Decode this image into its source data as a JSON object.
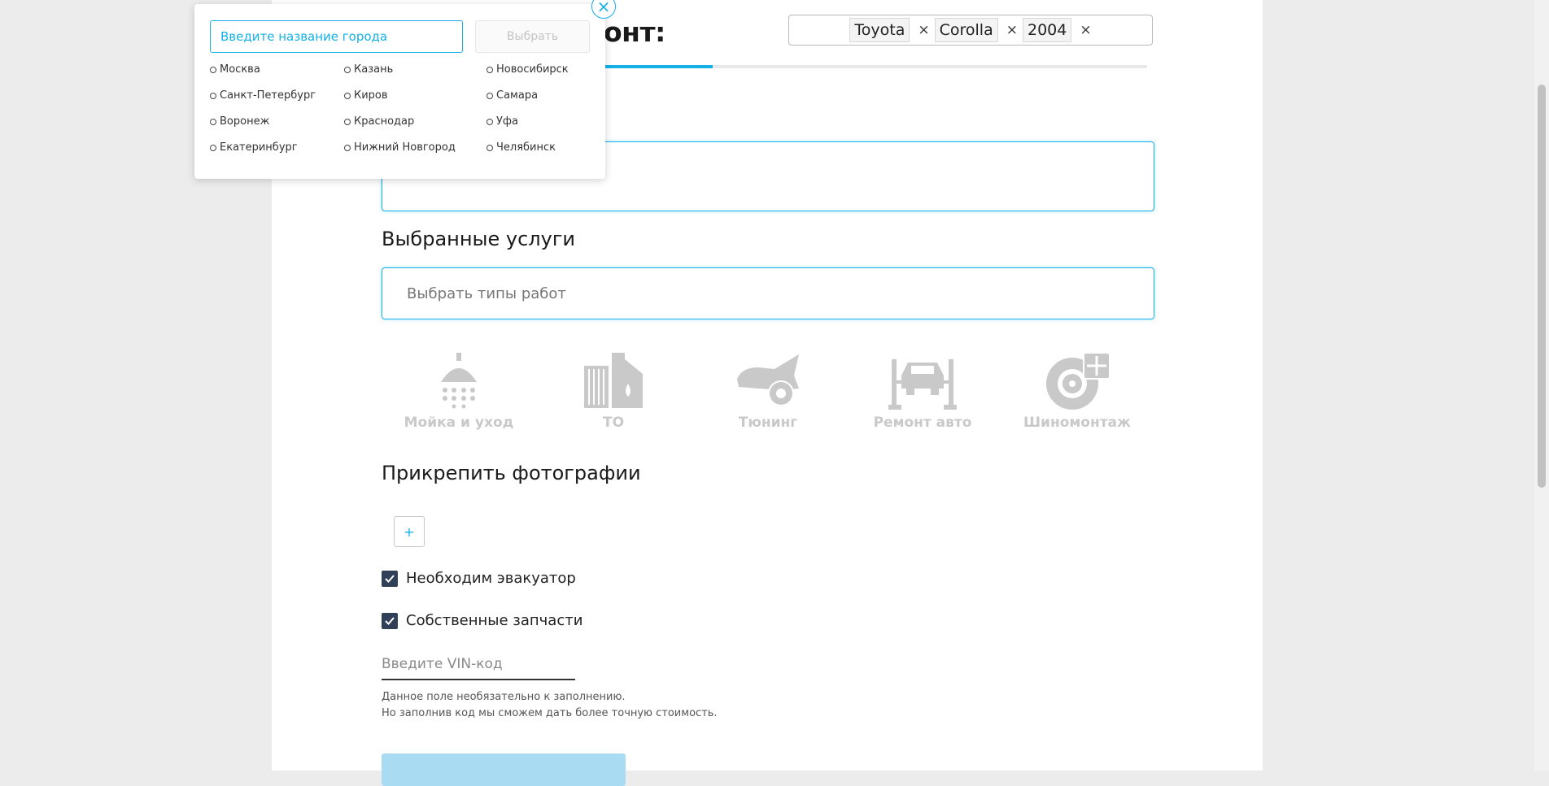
{
  "header": {
    "title_tail": "онт:",
    "car_tags": [
      {
        "label": "Toyota",
        "remove": "×"
      },
      {
        "label": "Corolla",
        "remove": "×"
      },
      {
        "label": "2004",
        "remove": "×"
      }
    ],
    "progress_fraction": 0.2
  },
  "sections": {
    "selected_services_title": "Выбранные услуги",
    "select_placeholder": "Выбрать типы работ",
    "photos_title": "Прикрепить фотографии",
    "add_photo_label": "+"
  },
  "services": [
    {
      "label": "Мойка и уход",
      "icon": "shower-icon"
    },
    {
      "label": "ТО",
      "icon": "oil-filter-icon"
    },
    {
      "label": "Тюнинг",
      "icon": "tuning-car-icon"
    },
    {
      "label": "Ремонт авто",
      "icon": "car-lift-icon"
    },
    {
      "label": "Шиномонтаж",
      "icon": "tire-wrench-icon"
    }
  ],
  "options": {
    "tow_truck": {
      "label": "Необходим эвакуатор",
      "checked": true
    },
    "own_parts": {
      "label": "Собственные запчасти",
      "checked": true
    }
  },
  "vin": {
    "placeholder": "Введите VIN-код",
    "hint_line1": "Данное поле необязательно к заполнению.",
    "hint_line2": "Но заполнив код мы сможем дать более точную стоимость."
  },
  "city_popup": {
    "input_placeholder": "Введите название города",
    "choose_label": "Выбрать",
    "close_label": "×",
    "cities": [
      [
        "Москва",
        "Казань",
        "Новосибирск"
      ],
      [
        "Санкт-Петербург",
        "Киров",
        "Самара"
      ],
      [
        "Воронеж",
        "Краснодар",
        "Уфа"
      ],
      [
        "Екатеринбург",
        "Нижний Новгород",
        "Челябинск"
      ]
    ]
  },
  "colors": {
    "accent": "#14b1e7",
    "checkbox": "#2f4058",
    "disabled_icon": "#c9c9c9",
    "submit_disabled": "#a9dcf3"
  }
}
